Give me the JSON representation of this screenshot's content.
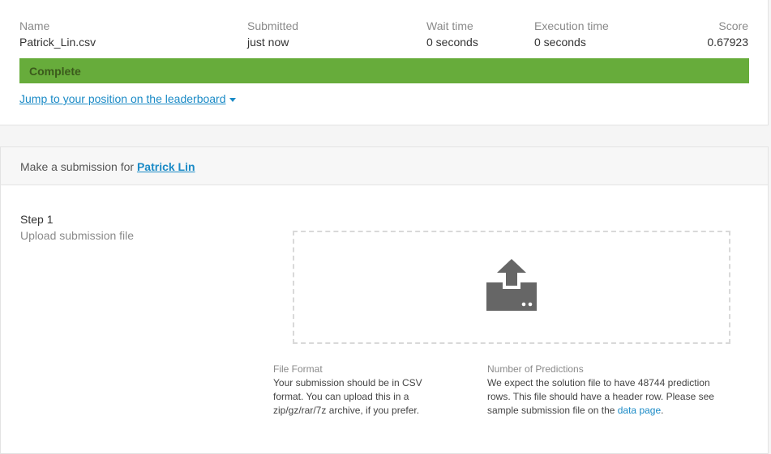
{
  "submission": {
    "name_label": "Name",
    "name_value": "Patrick_Lin.csv",
    "submitted_label": "Submitted",
    "submitted_value": "just now",
    "wait_label": "Wait time",
    "wait_value": "0 seconds",
    "exec_label": "Execution time",
    "exec_value": "0 seconds",
    "score_label": "Score",
    "score_value": "0.67923",
    "status": "Complete",
    "status_color": "#67ac3b",
    "jump_link": "Jump to your position on the leaderboard"
  },
  "make_submission": {
    "prefix": "Make a submission for ",
    "competition": "Patrick Lin",
    "step_title": "Step 1",
    "step_subtitle": "Upload submission file",
    "upload_icon": "upload-icon",
    "file_format_title": "File Format",
    "file_format_text": "Your submission should be in CSV format. You can upload this in a zip/gz/rar/7z archive, if you prefer.",
    "predictions_title": "Number of Predictions",
    "predictions_text": "We expect the solution file to have 48744 prediction rows. This file should have a header row. Please see sample submission file on the ",
    "data_page_link": "data page",
    "predictions_end": "."
  },
  "colors": {
    "link": "#1a8ac6",
    "status_bar": "#67ac3b"
  }
}
